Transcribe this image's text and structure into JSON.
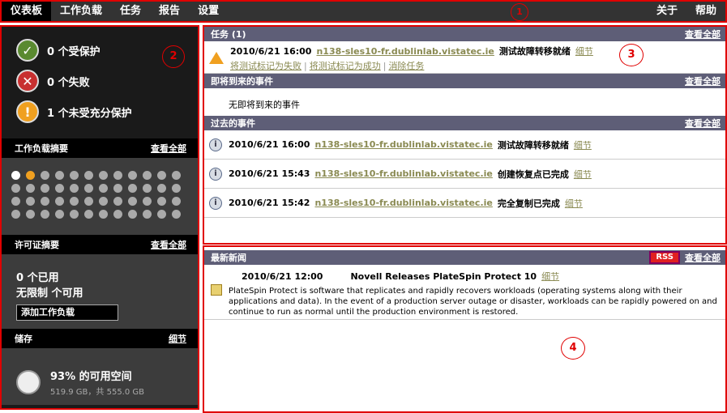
{
  "nav": {
    "items": [
      "仪表板",
      "工作负载",
      "任务",
      "报告",
      "设置"
    ],
    "right": [
      "关于",
      "帮助"
    ]
  },
  "callouts": [
    "1",
    "2",
    "3",
    "4"
  ],
  "left": {
    "status": [
      {
        "icon": "check-icon",
        "text": "0 个受保护"
      },
      {
        "icon": "x-icon",
        "text": "0 个失败"
      },
      {
        "icon": "exclamation-icon",
        "text": "1 个未受充分保护"
      }
    ],
    "workload_title": "工作负载摘要",
    "view_all": "查看全部",
    "license_title": "许可证摘要",
    "license_used": "0 个已用",
    "license_avail": "无限制 个可用",
    "add_workload": "添加工作负载",
    "storage_title": "储存",
    "storage_detail": "细节",
    "storage_pct": "93% 的可用空间",
    "storage_size": "519.9 GB，共 555.0 GB",
    "dots": {
      "count": 48,
      "white": [
        0
      ],
      "orange": [
        1
      ]
    }
  },
  "tasks": {
    "title": "任务 (1)",
    "view_all": "查看全部",
    "date": "2010/6/21 16:00",
    "host": "n138-sles10-fr.dublinlab.vistatec.ie",
    "desc": "测试故障转移就绪",
    "detail": "细节",
    "actions": [
      "将测试标记为失败",
      "将测试标记为成功",
      "消除任务"
    ]
  },
  "upcoming": {
    "title": "即将到来的事件",
    "view_all": "查看全部",
    "empty": "无即将到来的事件"
  },
  "past": {
    "title": "过去的事件",
    "view_all": "查看全部",
    "rows": [
      {
        "date": "2010/6/21 16:00",
        "host": "n138-sles10-fr.dublinlab.vistatec.ie",
        "desc": "测试故障转移就绪",
        "detail": "细节"
      },
      {
        "date": "2010/6/21 15:43",
        "host": "n138-sles10-fr.dublinlab.vistatec.ie",
        "desc": "创建恢复点已完成",
        "detail": "细节"
      },
      {
        "date": "2010/6/21 15:42",
        "host": "n138-sles10-fr.dublinlab.vistatec.ie",
        "desc": "完全复制已完成",
        "detail": "细节"
      }
    ]
  },
  "news": {
    "title": "最新新闻",
    "rss": "RSS",
    "view_all": "查看全部",
    "date": "2010/6/21 12:00",
    "headline": "Novell Releases PlateSpin Protect 10",
    "detail": "细节",
    "body": "PlateSpin Protect is software that replicates and rapidly recovers workloads (operating systems along with their applications and data). In the event of a production server outage or disaster, workloads can be rapidly powered on and continue to run as normal until the production environment is restored."
  }
}
